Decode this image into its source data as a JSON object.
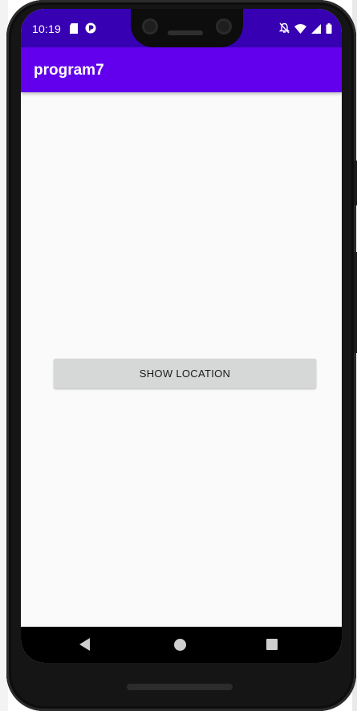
{
  "status_bar": {
    "time": "10:19",
    "left_icons": [
      "sd-card-icon",
      "app-notification-icon"
    ],
    "right_icons": [
      "do-not-disturb-icon",
      "wifi-icon",
      "cellular-signal-icon",
      "battery-icon"
    ],
    "color": "#3700b3"
  },
  "app_bar": {
    "title": "program7",
    "color": "#6200ee"
  },
  "main": {
    "button_label": "SHOW LOCATION"
  },
  "nav_bar": {
    "buttons": [
      "back",
      "home",
      "recents"
    ]
  }
}
